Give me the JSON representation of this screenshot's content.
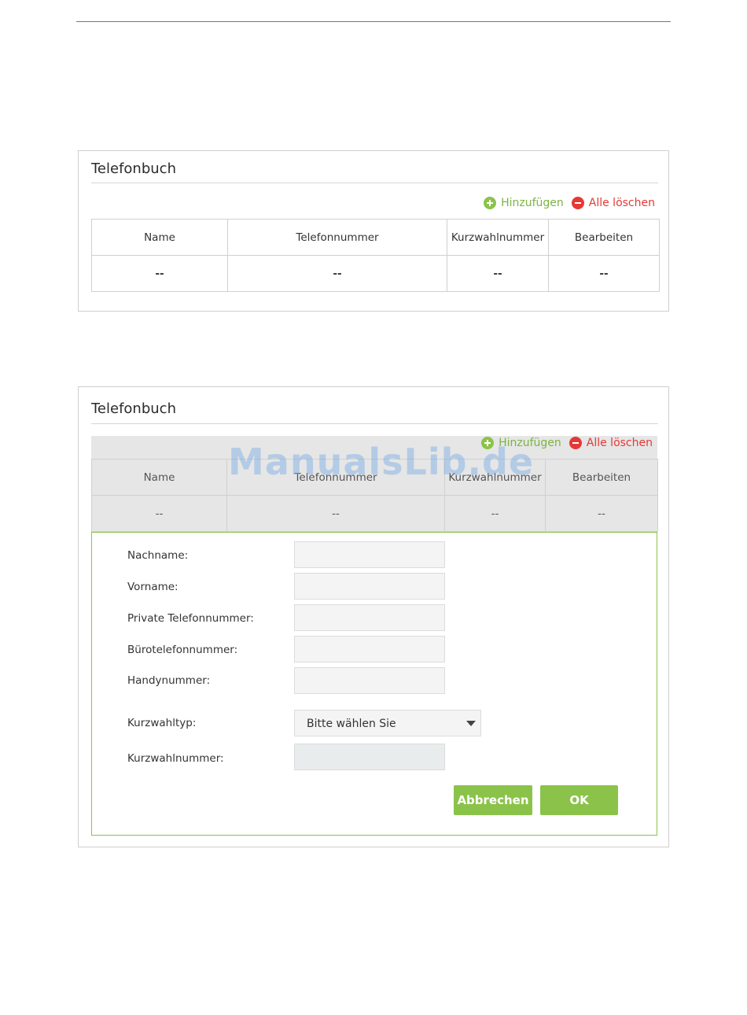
{
  "panel1": {
    "title": "Telefonbuch",
    "add_label": "Hinzufügen",
    "delete_all_label": "Alle löschen",
    "table": {
      "headers": [
        "Name",
        "Telefonnummer",
        "Kurzwahlnummer",
        "Bearbeiten"
      ],
      "row": [
        "--",
        "--",
        "--",
        "--"
      ]
    }
  },
  "panel2": {
    "title": "Telefonbuch",
    "add_label": "Hinzufügen",
    "delete_all_label": "Alle löschen",
    "table": {
      "headers": [
        "Name",
        "Telefonnummer",
        "Kurzwahlnummer",
        "Bearbeiten"
      ],
      "row": [
        "--",
        "--",
        "--",
        "--"
      ]
    },
    "form": {
      "last_name_label": "Nachname:",
      "first_name_label": "Vorname:",
      "private_phone_label": "Private Telefonnummer:",
      "office_phone_label": "Bürotelefonnummer:",
      "mobile_label": "Handynummer:",
      "speed_dial_type_label": "Kurzwahltyp:",
      "speed_dial_type_value": "Bitte wählen Sie",
      "speed_dial_number_label": "Kurzwahlnummer:",
      "cancel_label": "Abbrechen",
      "ok_label": "OK"
    }
  },
  "watermark": "ManualsLib.de",
  "colors": {
    "accent_green": "#8bc34a",
    "delete_red": "#e53935",
    "border_gray": "#cfcfcf"
  }
}
